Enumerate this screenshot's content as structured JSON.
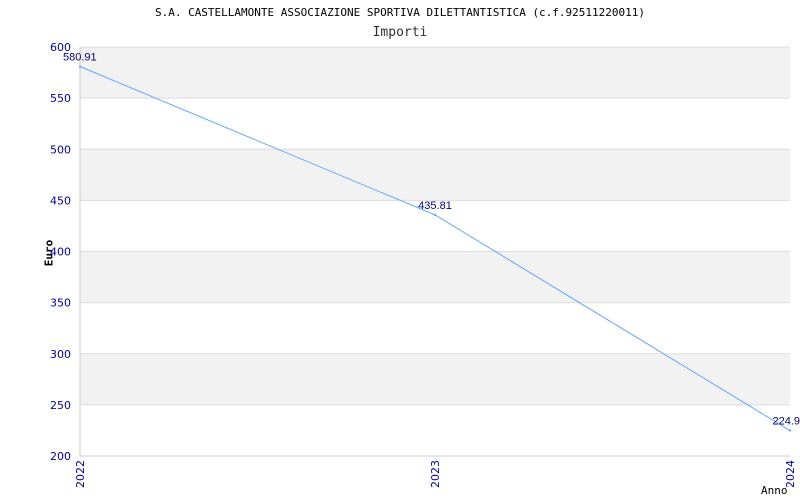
{
  "chart_data": {
    "type": "line",
    "title": "S.A. CASTELLAMONTE ASSOCIAZIONE SPORTIVA DILETTANTISTICA (c.f.92511220011)",
    "subtitle": "Importi",
    "xlabel": "Anno",
    "ylabel": "Euro",
    "x": [
      "2022",
      "2023",
      "2024"
    ],
    "series": [
      {
        "values": [
          580.91,
          435.81,
          224.9
        ],
        "labels": [
          "580.91",
          "435.81",
          "224.9"
        ]
      }
    ],
    "ylim": [
      200,
      600
    ],
    "yticks": [
      200,
      250,
      300,
      350,
      400,
      450,
      500,
      550,
      600
    ],
    "grid": true,
    "colors": {
      "line": "#66aaff",
      "band": "#f2f2f2",
      "tick": "#0000aa",
      "data_label": "#000080"
    }
  }
}
